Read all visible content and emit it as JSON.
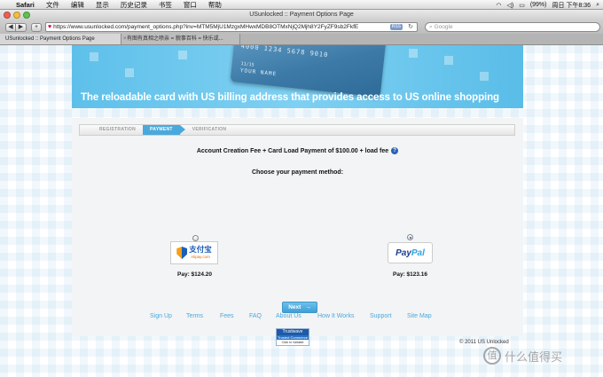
{
  "menubar": {
    "app": "Safari",
    "items": [
      "文件",
      "编辑",
      "显示",
      "历史记录",
      "书签",
      "窗口",
      "帮助"
    ],
    "battery": "(99%)",
    "clock": "周日 下午8:36"
  },
  "window": {
    "title": "USunlocked :: Payment Options Page"
  },
  "toolbar": {
    "back": "◀",
    "forward": "▶",
    "add": "+",
    "url": "https://www.usunlocked.com/payment_options.php?inv=MTM5MjU1MzgxMHwxMDB8OTMxNjQ2Mjh8Y2FyZF9sb2FkfE",
    "rss": "RSS",
    "search_placeholder": "Google"
  },
  "tabs": [
    {
      "label": "USunlocked :: Payment Options Page"
    },
    {
      "label": "有图有真相之喷亲 = 貌事百科 = 快乐或..."
    }
  ],
  "banner": {
    "card_number": "4000 1234 5678 9010",
    "card_expiry": "11/15",
    "card_name": "YOUR NAME",
    "tagline": "The reloadable card with US billing address that provides access to US online shopping"
  },
  "steps": [
    {
      "label": "REGISTRATION",
      "active": false
    },
    {
      "label": "PAYMENT",
      "active": true
    },
    {
      "label": "VERIFICATION",
      "active": false
    }
  ],
  "payment": {
    "fee_text": "Account Creation Fee + Card Load Payment of $100.00 + load fee",
    "help": "?",
    "choose_text": "Choose your payment method:",
    "alipay": {
      "cn": "支付宝",
      "en": "Alipay.com",
      "price": "Pay: $124.20",
      "selected": false
    },
    "paypal": {
      "pay": "Pay",
      "pal": "Pal",
      "price": "Pay: $123.16",
      "selected": true
    },
    "next_label": "Next",
    "next_arrow": "→"
  },
  "footer": {
    "links": [
      "Sign Up",
      "Terms",
      "Fees",
      "FAQ",
      "About Us",
      "How It Works",
      "Support",
      "Site Map"
    ],
    "trust_top": "Trustwave",
    "trust_mid": "Trusted Commerce",
    "trust_bot": "Click to Validate",
    "copyright": "© 2011 US Unlocked"
  },
  "watermark": {
    "badge": "值",
    "text": "什么值得买"
  },
  "colors": {
    "accent": "#4aa9dc",
    "banner": "#5ec0ea",
    "panel": "#f3f4f5"
  }
}
